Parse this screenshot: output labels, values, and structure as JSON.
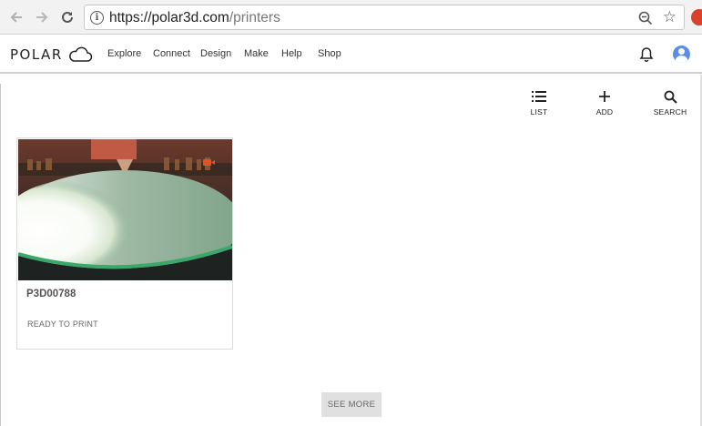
{
  "browser": {
    "url_host": "https://polar3d.com",
    "url_path": "/printers",
    "back_icon": "arrow-left-icon",
    "forward_icon": "arrow-right-icon",
    "reload_icon": "reload-icon",
    "info_icon": "info-icon",
    "zoom_icon": "zoom-out-icon",
    "bookmark_icon": "star-icon"
  },
  "header": {
    "logo_text": "POLAR",
    "nav": [
      "Explore",
      "Connect",
      "Design",
      "Make",
      "Help",
      "Shop"
    ]
  },
  "toolbar": {
    "list_label": "LIST",
    "add_label": "ADD",
    "search_label": "SEARCH"
  },
  "printers": [
    {
      "name": "P3D00788",
      "status": "READY TO PRINT"
    }
  ],
  "see_more_label": "SEE MORE",
  "colors": {
    "accent_brand": "#222222",
    "avatar": "#5b8fe6",
    "camera_badge": "#e8501f"
  }
}
